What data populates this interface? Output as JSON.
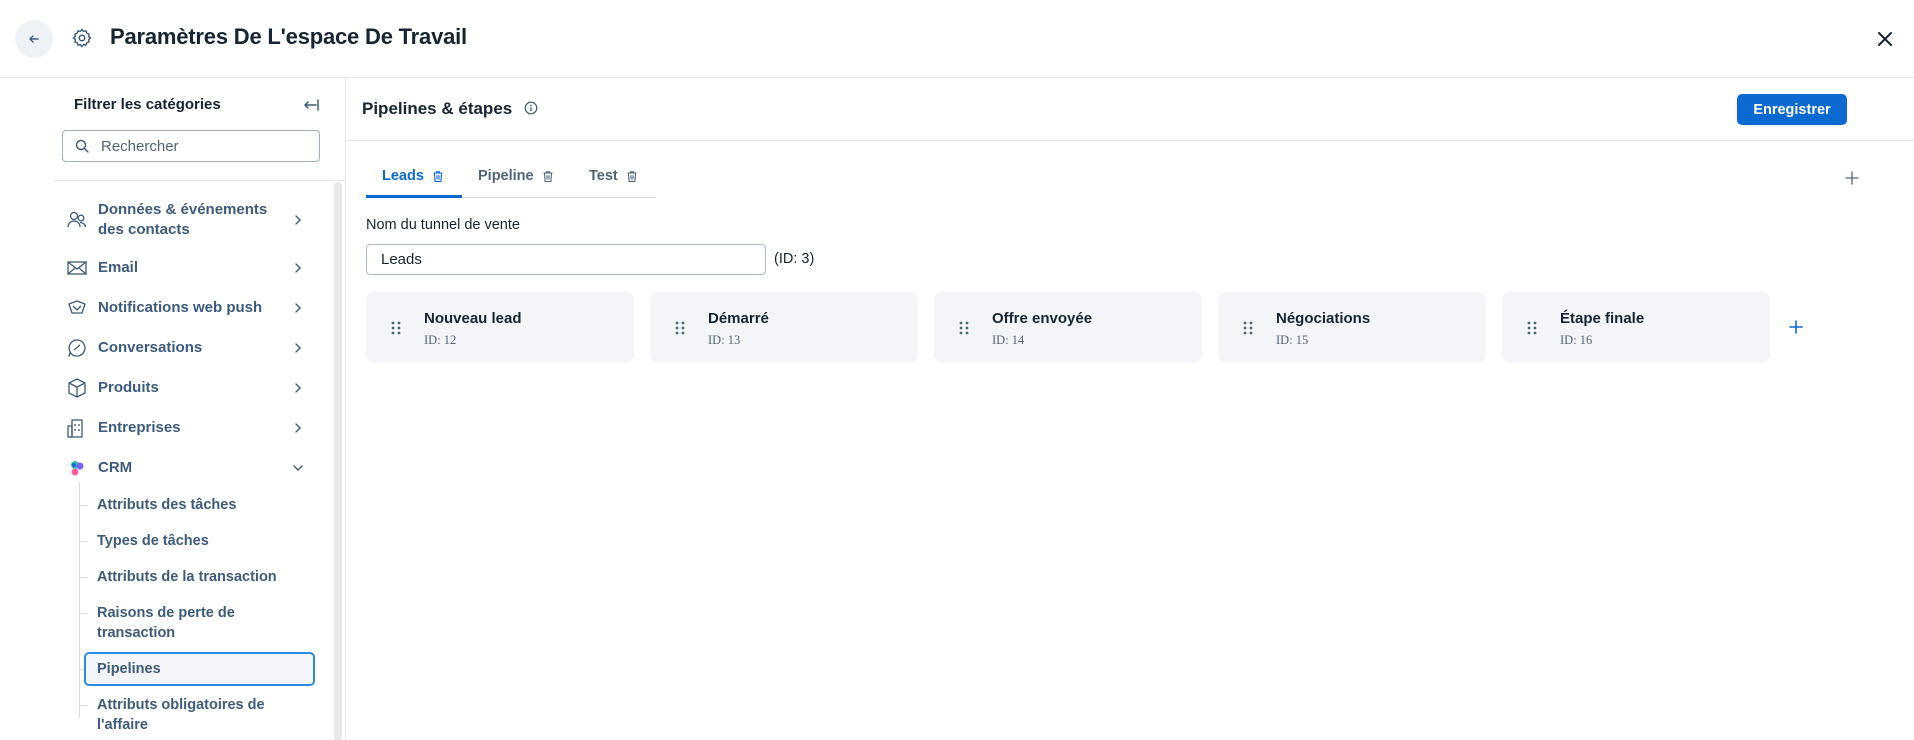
{
  "header": {
    "title": "Paramètres De L'espace De Travail"
  },
  "sidebar": {
    "filter_title": "Filtrer les catégories",
    "search_placeholder": "Rechercher",
    "items": [
      {
        "label": "Données & événements des contacts",
        "icon": "contacts-icon"
      },
      {
        "label": "Email",
        "icon": "envelope-icon"
      },
      {
        "label": "Notifications web push",
        "icon": "web-push-icon"
      },
      {
        "label": "Conversations",
        "icon": "chat-icon"
      },
      {
        "label": "Produits",
        "icon": "box-icon"
      },
      {
        "label": "Entreprises",
        "icon": "building-icon"
      },
      {
        "label": "CRM",
        "icon": "crm-icon"
      }
    ],
    "crm_sub_items": [
      "Attributs des tâches",
      "Types de tâches",
      "Attributs de la transaction",
      "Raisons de perte de transaction",
      "Pipelines",
      "Attributs obligatoires de l'affaire"
    ],
    "active_sub_item": "Pipelines"
  },
  "main": {
    "title": "Pipelines & étapes",
    "save_label": "Enregistrer",
    "tabs": [
      {
        "label": "Leads",
        "active": true
      },
      {
        "label": "Pipeline",
        "active": false
      },
      {
        "label": "Test",
        "active": false
      }
    ],
    "field_label": "Nom du tunnel de vente",
    "field_value": "Leads",
    "field_id": "(ID: 3)",
    "stages": [
      {
        "name": "Nouveau lead",
        "id": "ID: 12"
      },
      {
        "name": "Démarré",
        "id": "ID: 13"
      },
      {
        "name": "Offre envoyée",
        "id": "ID: 14"
      },
      {
        "name": "Négociations",
        "id": "ID: 15"
      },
      {
        "name": "Étape finale",
        "id": "ID: 16"
      }
    ]
  },
  "colors": {
    "accent": "#0a6ad1",
    "active_border": "#2a8be0",
    "nav_text": "#3e5a7d",
    "stage_bg": "#f3f5f8"
  }
}
